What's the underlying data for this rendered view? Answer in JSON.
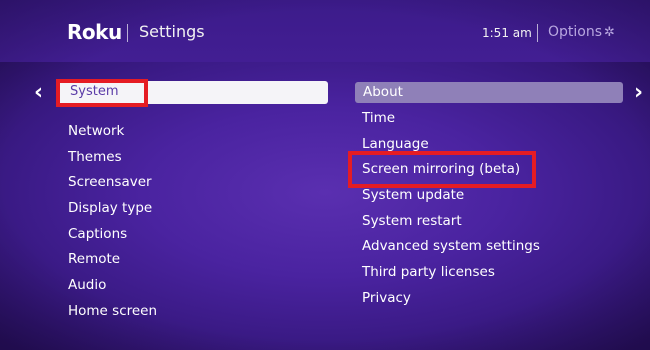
{
  "header": {
    "logo": "Roku",
    "title": "Settings",
    "time": "1:51  am",
    "options_label": "Options",
    "options_icon": "gear-icon"
  },
  "nav": {
    "left_arrow": "‹",
    "right_arrow": "›"
  },
  "left_menu": {
    "selected": "System",
    "items": [
      "Network",
      "Themes",
      "Screensaver",
      "Display type",
      "Captions",
      "Remote",
      "Audio",
      "Home screen"
    ]
  },
  "right_menu": {
    "selected": "About",
    "items": [
      "Time",
      "Language",
      "Screen mirroring (beta)",
      "System update",
      "System restart",
      "Advanced system settings",
      "Third party licenses",
      "Privacy"
    ]
  },
  "colors": {
    "background": "#4a23a0",
    "highlight_outline": "#e51c24",
    "selected_left_bg": "#f5f4f8",
    "selected_right_bg": "#8f80b8"
  }
}
